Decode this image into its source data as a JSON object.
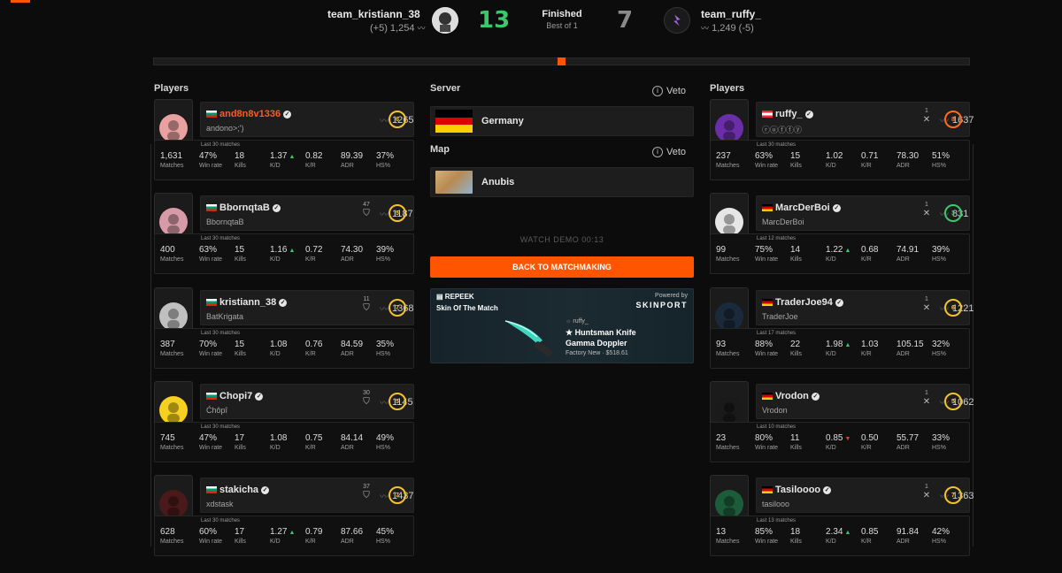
{
  "header": {
    "left_team": "team_kristiann_38",
    "left_elo": "(+5) 1,254",
    "left_score": "13",
    "status": "Finished",
    "format": "Best of 1",
    "right_score": "7",
    "right_team": "team_ruffy_",
    "right_elo": "1,249 (-5)"
  },
  "sections": {
    "players_left": "Players",
    "players_right": "Players",
    "server": "Server",
    "map": "Map",
    "veto": "Veto"
  },
  "server": {
    "name": "Germany"
  },
  "map": {
    "name": "Anubis"
  },
  "actions": {
    "watch_demo": "WATCH DEMO  00:13",
    "back": "BACK TO MATCHMAKING"
  },
  "promo": {
    "brand": "REPEEK",
    "title": "Skin Of The Match",
    "powered": "Powered by",
    "partner": "SKINPORT",
    "owner": "ruffy_",
    "item": "★ Huntsman Knife",
    "skin": "Gamma Doppler",
    "price": "Factory New · $518.61"
  },
  "stat_labels": [
    "Matches",
    "Win rate",
    "Kills",
    "K/D",
    "K/R",
    "ADR",
    "HS%"
  ],
  "team_left": [
    {
      "name": "and8n8v1336",
      "nick": "andono>;')",
      "elo": "1265",
      "level": "6",
      "level_color": "#f2c230",
      "trophies": "",
      "last": "Last 30 matches",
      "matches": "1,631",
      "winrate": "47%",
      "kills": "18",
      "kd": "1.37",
      "kd_trend": "up",
      "kr": "0.82",
      "adr": "89.39",
      "hs": "37%"
    },
    {
      "name": "BbornqtaB",
      "nick": "BbornqtaB",
      "elo": "1187",
      "level": "5",
      "level_color": "#f2c230",
      "trophies": "47",
      "last": "Last 30 matches",
      "matches": "400",
      "winrate": "63%",
      "kills": "15",
      "kd": "1.16",
      "kd_trend": "up",
      "kr": "0.72",
      "adr": "74.30",
      "hs": "39%"
    },
    {
      "name": "kristiann_38",
      "nick": "BatKrigata",
      "elo": "1368",
      "level": "7",
      "level_color": "#f2c230",
      "trophies": "11",
      "last": "Last 30 matches",
      "matches": "387",
      "winrate": "70%",
      "kills": "15",
      "kd": "1.08",
      "kd_trend": "",
      "kr": "0.76",
      "adr": "84.59",
      "hs": "35%"
    },
    {
      "name": "Chopi7",
      "nick": "Ćhôpî",
      "elo": "1145",
      "level": "5",
      "level_color": "#f2c230",
      "trophies": "30",
      "last": "Last 30 matches",
      "matches": "745",
      "winrate": "47%",
      "kills": "17",
      "kd": "1.08",
      "kd_trend": "",
      "kr": "0.75",
      "adr": "84.14",
      "hs": "49%"
    },
    {
      "name": "stakicha",
      "nick": "xdstask",
      "elo": "1437",
      "level": "7",
      "level_color": "#f2c230",
      "trophies": "37",
      "last": "Last 30 matches",
      "matches": "628",
      "winrate": "60%",
      "kills": "17",
      "kd": "1.27",
      "kd_trend": "up",
      "kr": "0.79",
      "adr": "87.66",
      "hs": "45%"
    }
  ],
  "team_right": [
    {
      "name": "ruffy_",
      "nick": "ⓡⓤⓕⓕⓨ",
      "elo": "1637",
      "level": "8",
      "level_color": "#ff6a1f",
      "trophies": "1",
      "last": "Last 30 matches",
      "matches": "237",
      "winrate": "63%",
      "kills": "15",
      "kd": "1.02",
      "kd_trend": "",
      "kr": "0.71",
      "adr": "78.30",
      "hs": "51%"
    },
    {
      "name": "MarcDerBoi",
      "nick": "MarcDerBoi",
      "elo": "831",
      "level": "3",
      "level_color": "#38c96b",
      "trophies": "1",
      "last": "Last 12 matches",
      "matches": "99",
      "winrate": "75%",
      "kills": "14",
      "kd": "1.22",
      "kd_trend": "up",
      "kr": "0.68",
      "adr": "74.91",
      "hs": "39%"
    },
    {
      "name": "TraderJoe94",
      "nick": "TraderJoe",
      "elo": "1221",
      "level": "6",
      "level_color": "#f2c230",
      "trophies": "1",
      "last": "Last 17 matches",
      "matches": "93",
      "winrate": "88%",
      "kills": "22",
      "kd": "1.98",
      "kd_trend": "up",
      "kr": "1.03",
      "adr": "105.15",
      "hs": "32%"
    },
    {
      "name": "Vrodon",
      "nick": "Vrodon",
      "elo": "1062",
      "level": "5",
      "level_color": "#f2c230",
      "trophies": "1",
      "last": "Last 10 matches",
      "matches": "23",
      "winrate": "80%",
      "kills": "11",
      "kd": "0.85",
      "kd_trend": "down",
      "kr": "0.50",
      "adr": "55.77",
      "hs": "33%"
    },
    {
      "name": "Tasiloooo",
      "nick": "tasilooo",
      "elo": "1363",
      "level": "7",
      "level_color": "#f2c230",
      "trophies": "1",
      "last": "Last 13 matches",
      "matches": "13",
      "winrate": "85%",
      "kills": "18",
      "kd": "2.34",
      "kd_trend": "up",
      "kr": "0.85",
      "adr": "91.84",
      "hs": "42%"
    }
  ],
  "colors": {
    "accent": "#ff5500",
    "win": "#38c96b",
    "highlight_name": "#ff5a1f"
  }
}
